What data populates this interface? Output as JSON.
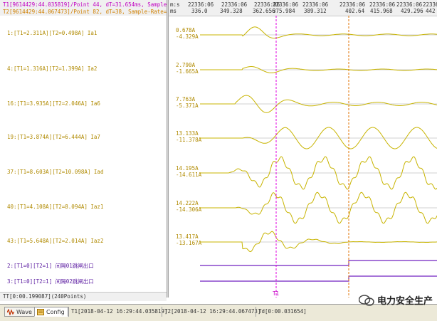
{
  "header": {
    "t1_line": "T1[9614429:44.035819]/Point 44, dT=31.654ms, Sample-Rate",
    "t2_line": "T2[9614429:44.067473]/Point 82, dT=38, Sample-Rate=1200H"
  },
  "time_axis": {
    "unit_top": "m:s",
    "unit_bottom": "ms",
    "ticks": [
      {
        "top": "22336:06",
        "bottom": "336.0"
      },
      {
        "top": "22336:06",
        "bottom": "349.328"
      },
      {
        "top": "22336:06",
        "bottom": "362.656"
      },
      {
        "top": "22336:06",
        "bottom": "375.984"
      },
      {
        "top": "22336:06",
        "bottom": "389.312"
      },
      {
        "top": "22336:06",
        "bottom": "402.64"
      },
      {
        "top": "22336:06",
        "bottom": "415.968"
      },
      {
        "top": "22336:06",
        "bottom": "429.296"
      },
      {
        "top": "22336:06",
        "bottom": "442"
      }
    ]
  },
  "channels": [
    {
      "label": "1:[T1=2.311A][T2=0.498A] Ia1",
      "max": "0.678A",
      "min": "-4.329A"
    },
    {
      "label": "4:[T1=1.316A][T2=1.399A] Ia2",
      "max": "2.790A",
      "min": "-1.665A"
    },
    {
      "label": "16:[T1=3.935A][T2=2.046A] Ia6",
      "max": "7.763A",
      "min": "-5.371A"
    },
    {
      "label": "19:[T1=3.874A][T2=6.444A] Ia7",
      "max": "13.133A",
      "min": "-11.378A"
    },
    {
      "label": "37:[T1=8.603A][T2=10.098A] Iad",
      "max": "14.195A",
      "min": "-14.611A"
    },
    {
      "label": "40:[T1=4.108A][T2=8.094A] Iaz1",
      "max": "14.222A",
      "min": "-14.306A"
    },
    {
      "label": "43:[T1=5.648A][T2=2.014A] Iaz2",
      "max": "13.417A",
      "min": "-13.167A"
    }
  ],
  "digital_channels": [
    {
      "label": "2:[T1=0][T2=1] 间隔01跳闸出口"
    },
    {
      "label": "3:[T1=0][T2=1] 间隔02跳闸出口"
    }
  ],
  "status_left": "TT[0:00.199087](240Points)",
  "cursor_label": "T1",
  "tabs": [
    {
      "label": "Wave",
      "icon": "wave-icon"
    },
    {
      "label": "Config",
      "icon": "config-icon"
    }
  ],
  "status_bar": {
    "t1": "T1[2018-04-12 16:29:44.035819]",
    "t2": "T2[2018-04-12 16:29:44.067473]",
    "td": "Td[0:00.031654]"
  },
  "watermark": "电力安全生产",
  "colors": {
    "wave": "#c8b400",
    "t1_cursor": "#e000e0",
    "t2_cursor": "#e07000",
    "digital": "#7020c0"
  }
}
